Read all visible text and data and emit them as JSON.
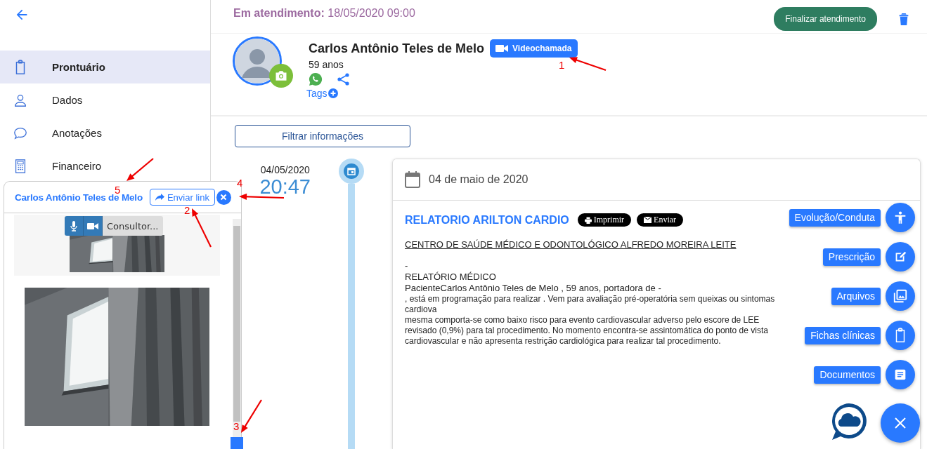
{
  "sidebar": {
    "items": [
      {
        "label": "Prontuário",
        "kind": "clipboard",
        "selected": true
      },
      {
        "label": "Dados",
        "kind": "person",
        "selected": false
      },
      {
        "label": "Anotações",
        "kind": "chat",
        "selected": false
      },
      {
        "label": "Financeiro",
        "kind": "calculator",
        "selected": false
      }
    ]
  },
  "header": {
    "status_label": "Em atendimento:",
    "status_value": "18/05/2020 09:00",
    "finish_button": "Finalizar atendimento"
  },
  "patient": {
    "name": "Carlos Antônio Teles de Melo",
    "video_button": "Videochamada",
    "age": "59 anos",
    "tags_label": "Tags"
  },
  "filter_button": "Filtrar informações",
  "timeline": {
    "date": "04/05/2020",
    "time": "20:47",
    "card_title": "04 de maio de 2020"
  },
  "report": {
    "title": "RELATORIO ARILTON CARDIO",
    "print_button": "Imprimir",
    "send_button": "Enviar",
    "lines": [
      {
        "kind": "heading",
        "text": "CENTRO DE SAÚDE MÉDICO E ODONTOLÓGICO ALFREDO MOREIRA LEITE"
      },
      {
        "kind": "text",
        "text": "-"
      },
      {
        "kind": "text",
        "text": "RELATÓRIO MÉDICO"
      },
      {
        "kind": "text",
        "text": "PacienteCarlos Antônio Teles de Melo , 59  anos, portadora de -"
      },
      {
        "kind": "small",
        "text": ", está em programação para realizar  . Vem para avaliação pré-operatória sem queixas ou sintomas cardiova"
      },
      {
        "kind": "small",
        "text": "mesma comporta-se como baixo risco para evento cardiovascular adverso pelo escore de LEE revisado (0,9%) para tal procedimento. No momento encontra-se assintomática do ponto de vista cardiovascular e não apresenta restrição cardiológica para realizar tal procedimento."
      }
    ]
  },
  "fab_actions": [
    {
      "label": "Evolução/Conduta",
      "kind": "person"
    },
    {
      "label": "Prescrição",
      "kind": "edit"
    },
    {
      "label": "Arquivos",
      "kind": "images"
    },
    {
      "label": "Fichas clínicas",
      "kind": "clipboard"
    },
    {
      "label": "Documentos",
      "kind": "document"
    }
  ],
  "video_panel": {
    "title": "Carlos Antônio Teles de Melo",
    "send_link_button": "Enviar link",
    "participant_label": "Consultor..."
  },
  "annotations": [
    "1",
    "2",
    "3",
    "4",
    "5"
  ]
}
